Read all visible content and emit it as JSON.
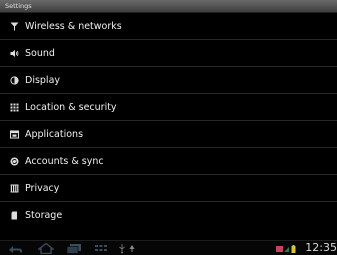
{
  "window": {
    "title": "Settings"
  },
  "settings": {
    "items": [
      {
        "label": "Wireless & networks",
        "icon": "wifi-icon"
      },
      {
        "label": "Sound",
        "icon": "speaker-icon"
      },
      {
        "label": "Display",
        "icon": "brightness-icon"
      },
      {
        "label": "Location & security",
        "icon": "grid-icon"
      },
      {
        "label": "Applications",
        "icon": "applications-icon"
      },
      {
        "label": "Accounts & sync",
        "icon": "sync-icon"
      },
      {
        "label": "Privacy",
        "icon": "privacy-icon"
      },
      {
        "label": "Storage",
        "icon": "storage-icon"
      }
    ]
  },
  "status_bar": {
    "time": "12:35",
    "icons": [
      "back-icon",
      "home-icon",
      "recent-apps-icon",
      "menu-icon",
      "usb-icon",
      "notification-icon",
      "wifi-signal-icon",
      "battery-icon"
    ]
  },
  "colors": {
    "background": "#000000",
    "title_bar": "#4a4a4a",
    "accent": "#33b5e5"
  }
}
